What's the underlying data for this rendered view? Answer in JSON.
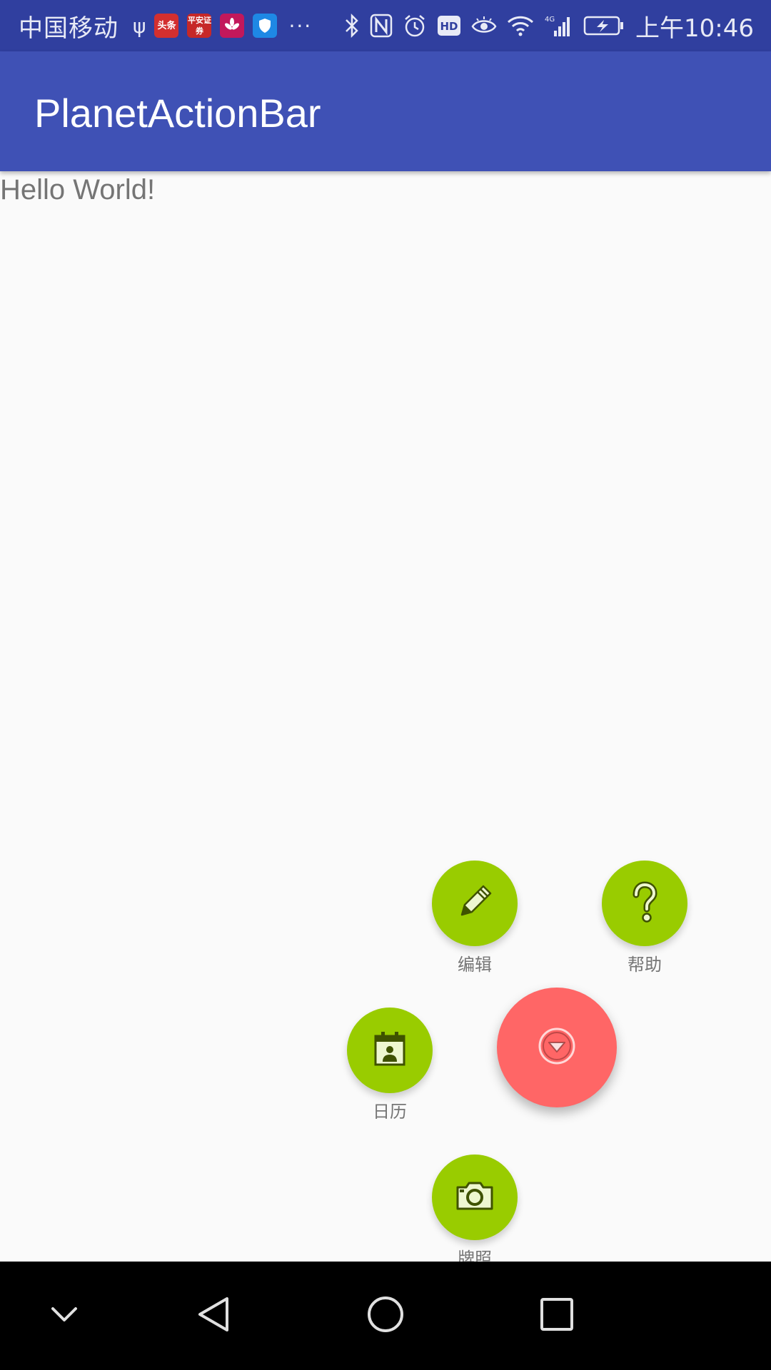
{
  "status_bar": {
    "carrier": "中国移动",
    "apps": [
      {
        "icon": "toutiao-app-icon",
        "text": "头条",
        "color": "#d32f2f"
      },
      {
        "icon": "pingan-app-icon",
        "text": "平安证券",
        "color": "#c62828"
      },
      {
        "icon": "huawei-app-icon",
        "text": "",
        "color": "#c2185b"
      },
      {
        "icon": "shield-app-icon",
        "text": "",
        "color": "#1e88e5"
      }
    ],
    "more": "···",
    "time": "上午10:46",
    "network": "4G"
  },
  "app_bar": {
    "title": "PlanetActionBar"
  },
  "content": {
    "text": "Hello World!"
  },
  "fab_menu": {
    "main_button": {
      "icon": "arrow-down-circle-icon",
      "color": "#ff6666"
    },
    "items": [
      {
        "icon": "pencil-icon",
        "label": "编辑",
        "color": "#99cc00"
      },
      {
        "icon": "question-icon",
        "label": "帮助",
        "color": "#99cc00"
      },
      {
        "icon": "calendar-icon",
        "label": "日历",
        "color": "#99cc00"
      },
      {
        "icon": "camera-icon",
        "label": "牌照",
        "color": "#99cc00"
      }
    ]
  },
  "nav_bar": {
    "buttons": [
      "down-chevron-icon",
      "back-icon",
      "home-icon",
      "recents-icon"
    ]
  },
  "colors": {
    "status_bar": "#303f9f",
    "app_bar": "#3f51b5",
    "background": "#fafafa"
  }
}
